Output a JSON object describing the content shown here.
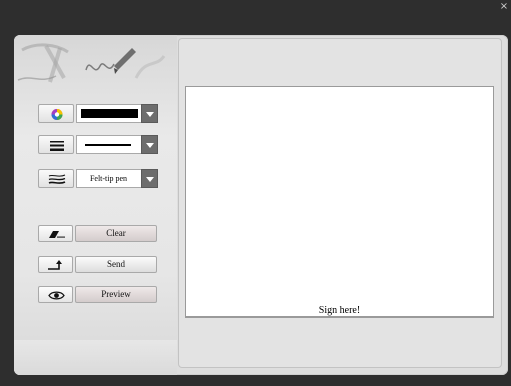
{
  "window": {
    "close_icon": "close-icon"
  },
  "toolbar": {
    "color": {
      "icon": "color-wheel-icon",
      "value": "#000000"
    },
    "line_width": {
      "icon": "line-width-icon"
    },
    "pen_type": {
      "icon": "pen-strokes-icon",
      "value": "Felt-tip pen"
    }
  },
  "actions": {
    "clear_label": "Clear",
    "send_label": "Send",
    "preview_label": "Preview"
  },
  "canvas": {
    "hint": "Sign here!"
  },
  "colors": {
    "accent_dark": "#6d6d6d",
    "panel": "#e3e3e3"
  }
}
